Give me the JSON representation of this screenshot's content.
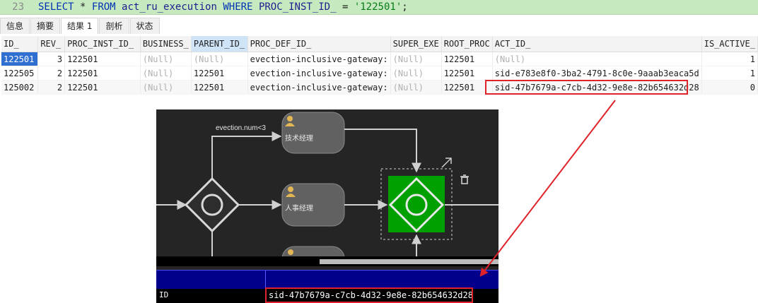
{
  "sql": {
    "line_number": "23",
    "kw_select": "SELECT",
    "star": "*",
    "kw_from": "FROM",
    "table": "act_ru_execution",
    "kw_where": "WHERE",
    "column": "PROC_INST_ID_",
    "eq": "=",
    "value": "'122501'",
    "semi": ";"
  },
  "tabs": [
    {
      "label": "信息"
    },
    {
      "label": "摘要"
    },
    {
      "label": "结果 1"
    },
    {
      "label": "剖析"
    },
    {
      "label": "状态"
    }
  ],
  "grid": {
    "columns": [
      "ID_",
      "REV_",
      "PROC_INST_ID_",
      "BUSINESS_",
      "PARENT_ID_",
      "PROC_DEF_ID_",
      "SUPER_EXE",
      "ROOT_PROC",
      "ACT_ID_",
      "IS_ACTIVE_"
    ],
    "rows": [
      [
        "122501",
        "3",
        "122501",
        "(Null)",
        "(Null)",
        "evection-inclusive-gateway:",
        "(Null)",
        "122501",
        "(Null)",
        "1"
      ],
      [
        "122505",
        "2",
        "122501",
        "(Null)",
        "122501",
        "evection-inclusive-gateway:",
        "(Null)",
        "122501",
        "sid-e783e8f0-3ba2-4791-8c0e-9aaab3eaca5d",
        "1"
      ],
      [
        "125002",
        "2",
        "122501",
        "(Null)",
        "122501",
        "evection-inclusive-gateway:",
        "(Null)",
        "122501",
        "sid-47b7679a-c7cb-4d32-9e8e-82b654632d28",
        "0"
      ]
    ]
  },
  "diagram": {
    "flow_condition": "evection.num<3",
    "task_1": "技术经理",
    "task_2": "人事经理"
  },
  "properties": {
    "key": "ID",
    "value": "sid-47b7679a-c7cb-4d32-9e8e-82b654632d28"
  },
  "colors": {
    "highlight": "#e0222a",
    "selected_gateway": "#00a000",
    "canvas_bg": "#252526"
  }
}
